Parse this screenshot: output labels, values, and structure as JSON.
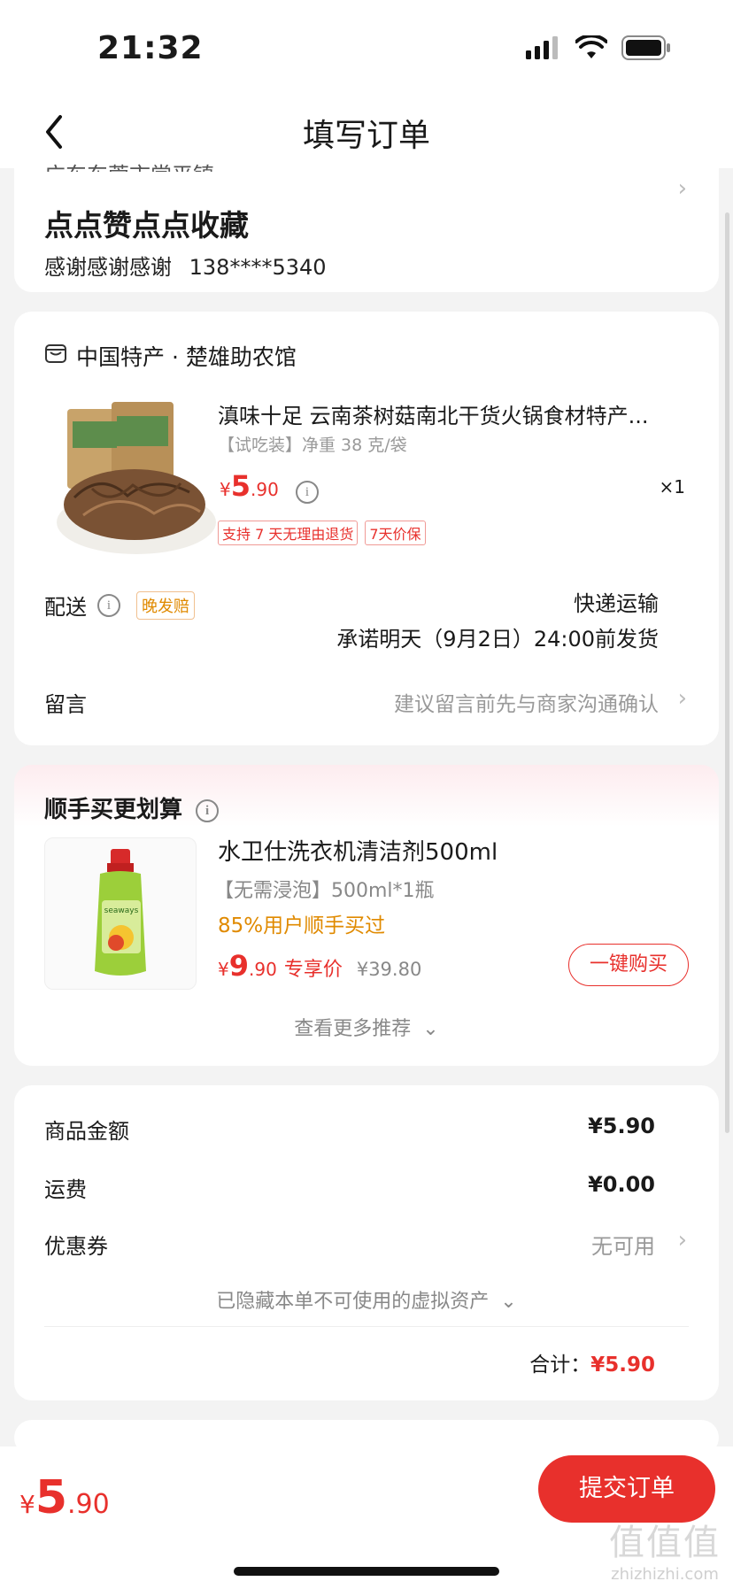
{
  "status_bar": {
    "time": "21:32"
  },
  "header": {
    "title": "填写订单"
  },
  "address": {
    "location": "广东东莞市常平镇",
    "name": "点点赞点点收藏",
    "contact_name": "感谢感谢感谢",
    "phone": "138****5340"
  },
  "shop": {
    "name": "中国特产 · 楚雄助农馆",
    "product": {
      "title": "滇味十足 云南茶树菇南北干货火锅食材特产...",
      "spec": "【试吃装】净重 38 克/袋",
      "price_yen": "¥",
      "price_int": "5",
      "price_dec": ".90",
      "qty": "×1",
      "tags": [
        "支持 7 天无理由退货",
        "7天价保"
      ]
    },
    "delivery": {
      "label": "配送",
      "late_tag": "晚发赔",
      "method": "快递运输",
      "promise": "承诺明天（9月2日）24:00前发货"
    },
    "message": {
      "label": "留言",
      "hint": "建议留言前先与商家沟通确认"
    }
  },
  "recommend": {
    "title": "顺手买更划算",
    "item": {
      "name": "水卫仕洗衣机清洁剂500ml",
      "spec": "【无需浸泡】500ml*1瓶",
      "percent": "85%用户顺手买过",
      "price_yen": "¥",
      "price_int": "9",
      "price_dec": ".90",
      "exclusive": "专享价",
      "orig_price": "¥39.80",
      "buy_label": "一键购买",
      "bottle_brand": "seaways"
    },
    "more": "查看更多推荐"
  },
  "summary": {
    "goods_label": "商品金额",
    "goods_value": "¥5.90",
    "freight_label": "运费",
    "freight_value": "¥0.00",
    "coupon_label": "优惠券",
    "coupon_value": "无可用",
    "hidden_assets": "已隐藏本单不可使用的虚拟资产",
    "total_label": "合计：",
    "total_value": "¥5.90"
  },
  "bottom": {
    "price_yen": "¥",
    "price_int": "5",
    "price_dec": ".90",
    "submit_label": "提交订单"
  },
  "watermark": {
    "big": "值值值",
    "small": "zhizhizhi.com"
  },
  "colors": {
    "accent": "#e8302c",
    "orange": "#e08a00"
  }
}
